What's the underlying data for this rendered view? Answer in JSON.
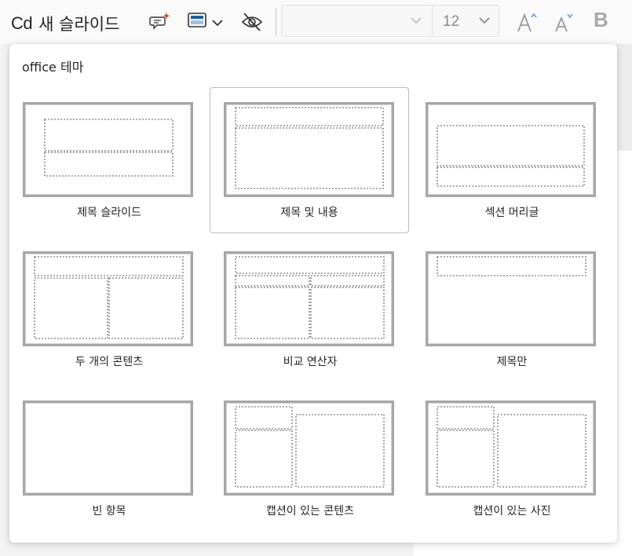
{
  "toolbar": {
    "new_slide_prefix": "Cd",
    "new_slide_label": "새 슬라이드",
    "font_name": "",
    "font_size": "12",
    "icons": {
      "designer": "designer-sparkle-icon",
      "layout": "layout-icon",
      "hide_slide": "hide-slide-icon",
      "grow_font": "grow-font-icon",
      "shrink_font": "shrink-font-icon",
      "bold": "bold-icon"
    },
    "bold_label": "B"
  },
  "dropdown": {
    "theme_title": "office 테마",
    "layouts": [
      {
        "label": "제목 슬라이드",
        "selected": false
      },
      {
        "label": "제목 및 내용",
        "selected": true
      },
      {
        "label": "섹션 머리글",
        "selected": false
      },
      {
        "label": "두 개의 콘텐츠",
        "selected": false
      },
      {
        "label": "비교 연산자",
        "selected": false
      },
      {
        "label": "제목만",
        "selected": false
      },
      {
        "label": "빈 항목",
        "selected": false
      },
      {
        "label": "캡션이 있는 콘텐츠",
        "selected": false
      },
      {
        "label": "캡션이 있는 사진",
        "selected": false
      }
    ]
  },
  "colors": {
    "accent_sparkle": "#c0502a",
    "layout_icon_blue": "#1f5f9c",
    "placeholder_dash": "#8f8f8f"
  }
}
